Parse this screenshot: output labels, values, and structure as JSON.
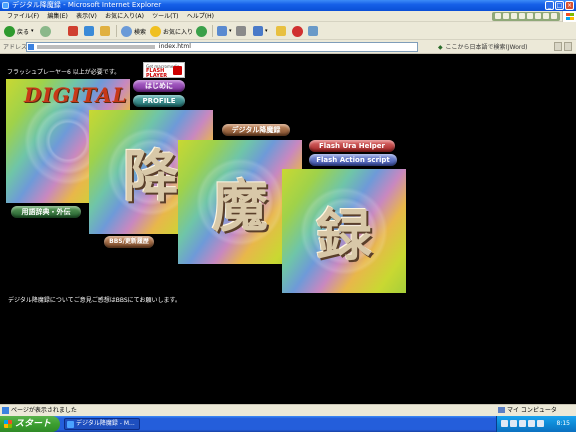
{
  "window": {
    "title": "デジタル降魔録 - Microsoft Internet Explorer",
    "min_label": "_",
    "max_label": "□",
    "close_label": "×"
  },
  "menu": [
    "ファイル(F)",
    "編集(E)",
    "表示(V)",
    "お気に入り(A)",
    "ツール(T)",
    "ヘルプ(H)"
  ],
  "toolbar": {
    "back_label": "戻る",
    "search_label": "検索",
    "favorites_label": "お気に入り"
  },
  "address": {
    "label": "アドレス(D)",
    "url_tail": "index.html",
    "search_hint": "ここから日本語で検索(JWord)",
    "go_arrow": "◆"
  },
  "page": {
    "plugin_note": "フラッシュプレーヤー6 以上が必要です。",
    "flash_badge_top": "Get macromedia",
    "flash_badge_line1": "FLASH",
    "flash_badge_line2": "PLAYER",
    "logo_text": "DIGITAL",
    "tiles": [
      {
        "kanji": ""
      },
      {
        "kanji": "降"
      },
      {
        "kanji": "魔"
      },
      {
        "kanji": "録"
      }
    ],
    "buttons": {
      "hajimeni": "はじめに",
      "profile": "PROFILE",
      "digital_gouma": "デジタル降魔録",
      "flash_ura_helper": "Flash Ura Helper",
      "flash_action_script": "Flash Action script",
      "yougo_jiten": "用語辞典・外伝",
      "bbs": "BBS/更新履歴"
    },
    "footer_note": "デジタル降魔録についてご意見ご感想はBBSにてお願いします。"
  },
  "status": {
    "text": "ページが表示されました",
    "zone": "マイ コンピュータ"
  },
  "taskbar": {
    "start_label": "スタート",
    "task_label": "デジタル降魔録 - M...",
    "clock": "8:15"
  },
  "colors": {
    "titlebar": "#0a4fd6",
    "chrome": "#ece9d8",
    "page_bg": "#000000",
    "start_green": "#3c9f30"
  }
}
